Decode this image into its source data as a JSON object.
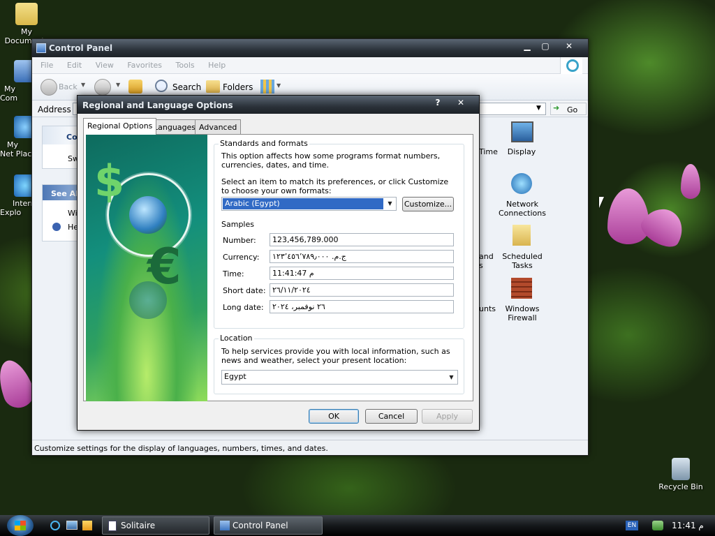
{
  "desktop": {
    "icons": [
      {
        "label": "My Documents"
      },
      {
        "label": "My Com"
      },
      {
        "label": "My Net Plac"
      },
      {
        "label": "Intern Explo"
      },
      {
        "label": "Recycle Bin"
      }
    ]
  },
  "control_panel": {
    "title": "Control Panel",
    "menu": [
      "File",
      "Edit",
      "View",
      "Favorites",
      "Tools",
      "Help"
    ],
    "toolbar": {
      "back": "Back",
      "search": "Search",
      "folders": "Folders"
    },
    "address_label": "Address",
    "go_label": "Go",
    "sidebar": {
      "box1_title": "Con",
      "box1_item": "Sw",
      "box2_title": "See Al",
      "box2_item1": "Wi",
      "box2_item2": "Hel"
    },
    "items": [
      {
        "label": "Time"
      },
      {
        "label": "Display"
      },
      {
        "label": "Network Connections"
      },
      {
        "label": "and s"
      },
      {
        "label": "Scheduled Tasks"
      },
      {
        "label": "unts"
      },
      {
        "label": "Windows Firewall"
      }
    ],
    "status": "Customize settings for the display of languages, numbers, times, and dates."
  },
  "dialog": {
    "title": "Regional and Language Options",
    "help_btn": "?",
    "close_btn": "✕",
    "tabs": [
      "Regional Options",
      "Languages",
      "Advanced"
    ],
    "standards": {
      "title": "Standards and formats",
      "desc": "This option affects how some programs format numbers, currencies, dates, and time.",
      "select_desc": "Select an item to match its preferences, or click Customize to choose your own formats:",
      "selected": "Arabic (Egypt)",
      "customize": "Customize..."
    },
    "samples": {
      "title": "Samples",
      "rows": [
        {
          "label": "Number:",
          "value": "123,456,789.000"
        },
        {
          "label": "Currency:",
          "value": "ج.م.‏ ١٢٣٬٤٥٦٬٧٨٩٫٠٠٠"
        },
        {
          "label": "Time:",
          "value": "11:41:47 م"
        },
        {
          "label": "Short date:",
          "value": "٢٦/١١/٢٠٢٤"
        },
        {
          "label": "Long date:",
          "value": "٢٦ نوفمبر، ٢٠٢٤"
        }
      ]
    },
    "location": {
      "title": "Location",
      "desc": "To help services provide you with local information, such as news and weather, select your present location:",
      "selected": "Egypt"
    },
    "buttons": {
      "ok": "OK",
      "cancel": "Cancel",
      "apply": "Apply"
    }
  },
  "taskbar": {
    "tasks": [
      {
        "label": "Solitaire"
      },
      {
        "label": "Control Panel"
      }
    ],
    "lang": "EN",
    "clock": "11:41 م"
  },
  "colors": {
    "title_dark": "#1d2227",
    "accent": "#316ac5",
    "dialog_bg": "#f0f0f0"
  }
}
